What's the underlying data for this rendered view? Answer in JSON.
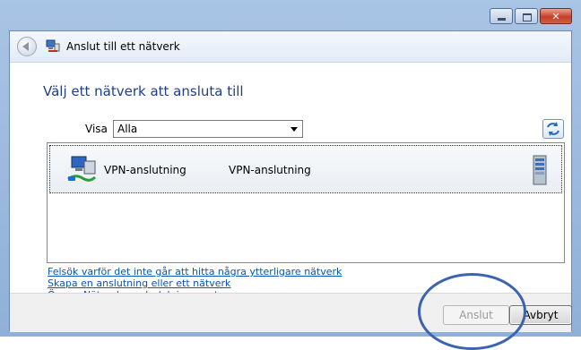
{
  "window": {
    "title": "Anslut till ett nätverk",
    "controls": {
      "minimize": "minimize",
      "maximize": "maximize",
      "close": "close"
    }
  },
  "main": {
    "heading": "Välj ett nätverk att ansluta till",
    "filter": {
      "label": "Visa",
      "selected": "Alla"
    },
    "networks": [
      {
        "name": "VPN-anslutning",
        "type": "VPN-anslutning",
        "icon": "vpn-connection-icon"
      }
    ],
    "links": [
      "Felsök varför det inte går att hitta några ytterligare nätverk",
      "Skapa en anslutning eller ett nätverk",
      "Öppna Nätverks- och delningscenter"
    ]
  },
  "footer": {
    "connect_label": "Anslut",
    "cancel_label": "Avbryt"
  },
  "colors": {
    "heading": "#1e3e8c",
    "link": "#0a54b3",
    "annotation_circle": "#3d63b0"
  }
}
